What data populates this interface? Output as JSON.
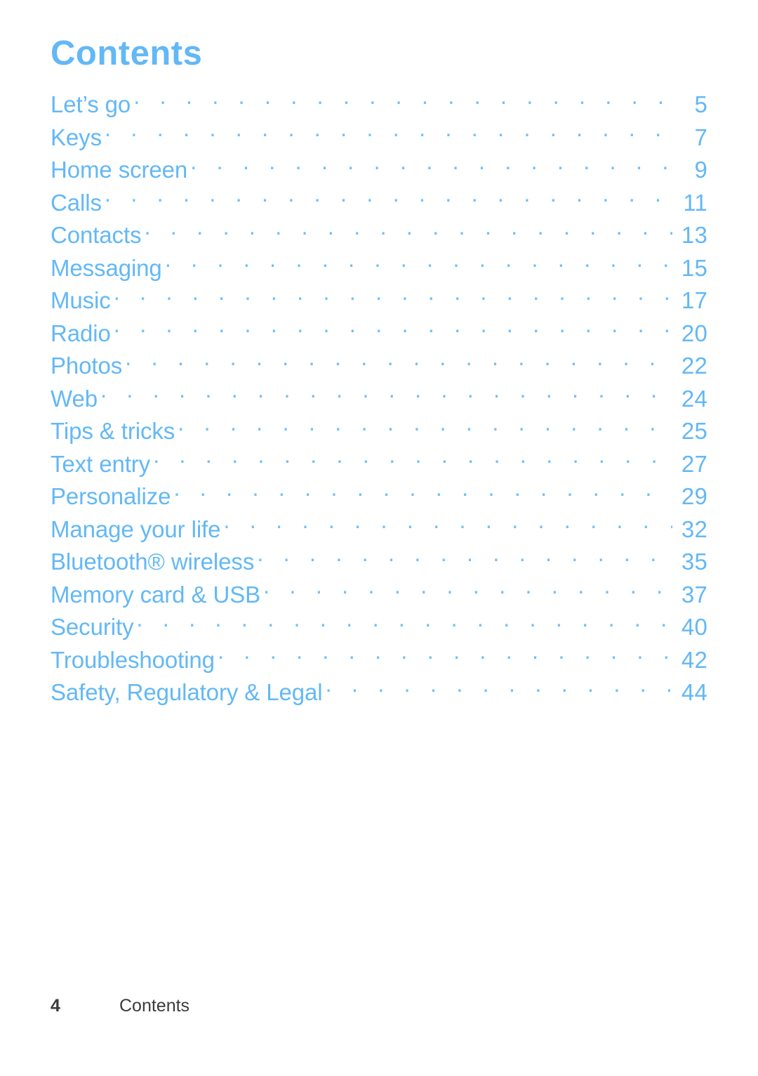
{
  "document": {
    "title": "Contents",
    "accent_color": "#63b8f6",
    "leader_color": "#72c0f7",
    "footer_color": "#3b3b3b",
    "background_color": "#ffffff"
  },
  "toc": {
    "entries": [
      {
        "label": "Let’s go",
        "page": "5"
      },
      {
        "label": "Keys",
        "page": "7"
      },
      {
        "label": "Home screen",
        "page": "9"
      },
      {
        "label": "Calls",
        "page": "11"
      },
      {
        "label": "Contacts",
        "page": "13"
      },
      {
        "label": "Messaging",
        "page": "15"
      },
      {
        "label": "Music",
        "page": "17"
      },
      {
        "label": "Radio",
        "page": "20"
      },
      {
        "label": "Photos",
        "page": "22"
      },
      {
        "label": "Web",
        "page": "24"
      },
      {
        "label": "Tips & tricks",
        "page": "25"
      },
      {
        "label": "Text entry",
        "page": "27"
      },
      {
        "label": "Personalize",
        "page": "29"
      },
      {
        "label": "Manage your life",
        "page": "32"
      },
      {
        "label": "Bluetooth® wireless",
        "page": "35"
      },
      {
        "label": "Memory card & USB",
        "page": "37"
      },
      {
        "label": "Security",
        "page": "40"
      },
      {
        "label": "Troubleshooting",
        "page": "42"
      },
      {
        "label": "Safety, Regulatory & Legal",
        "page": "44"
      }
    ]
  },
  "footer": {
    "page_number": "4",
    "section_title": "Contents"
  }
}
